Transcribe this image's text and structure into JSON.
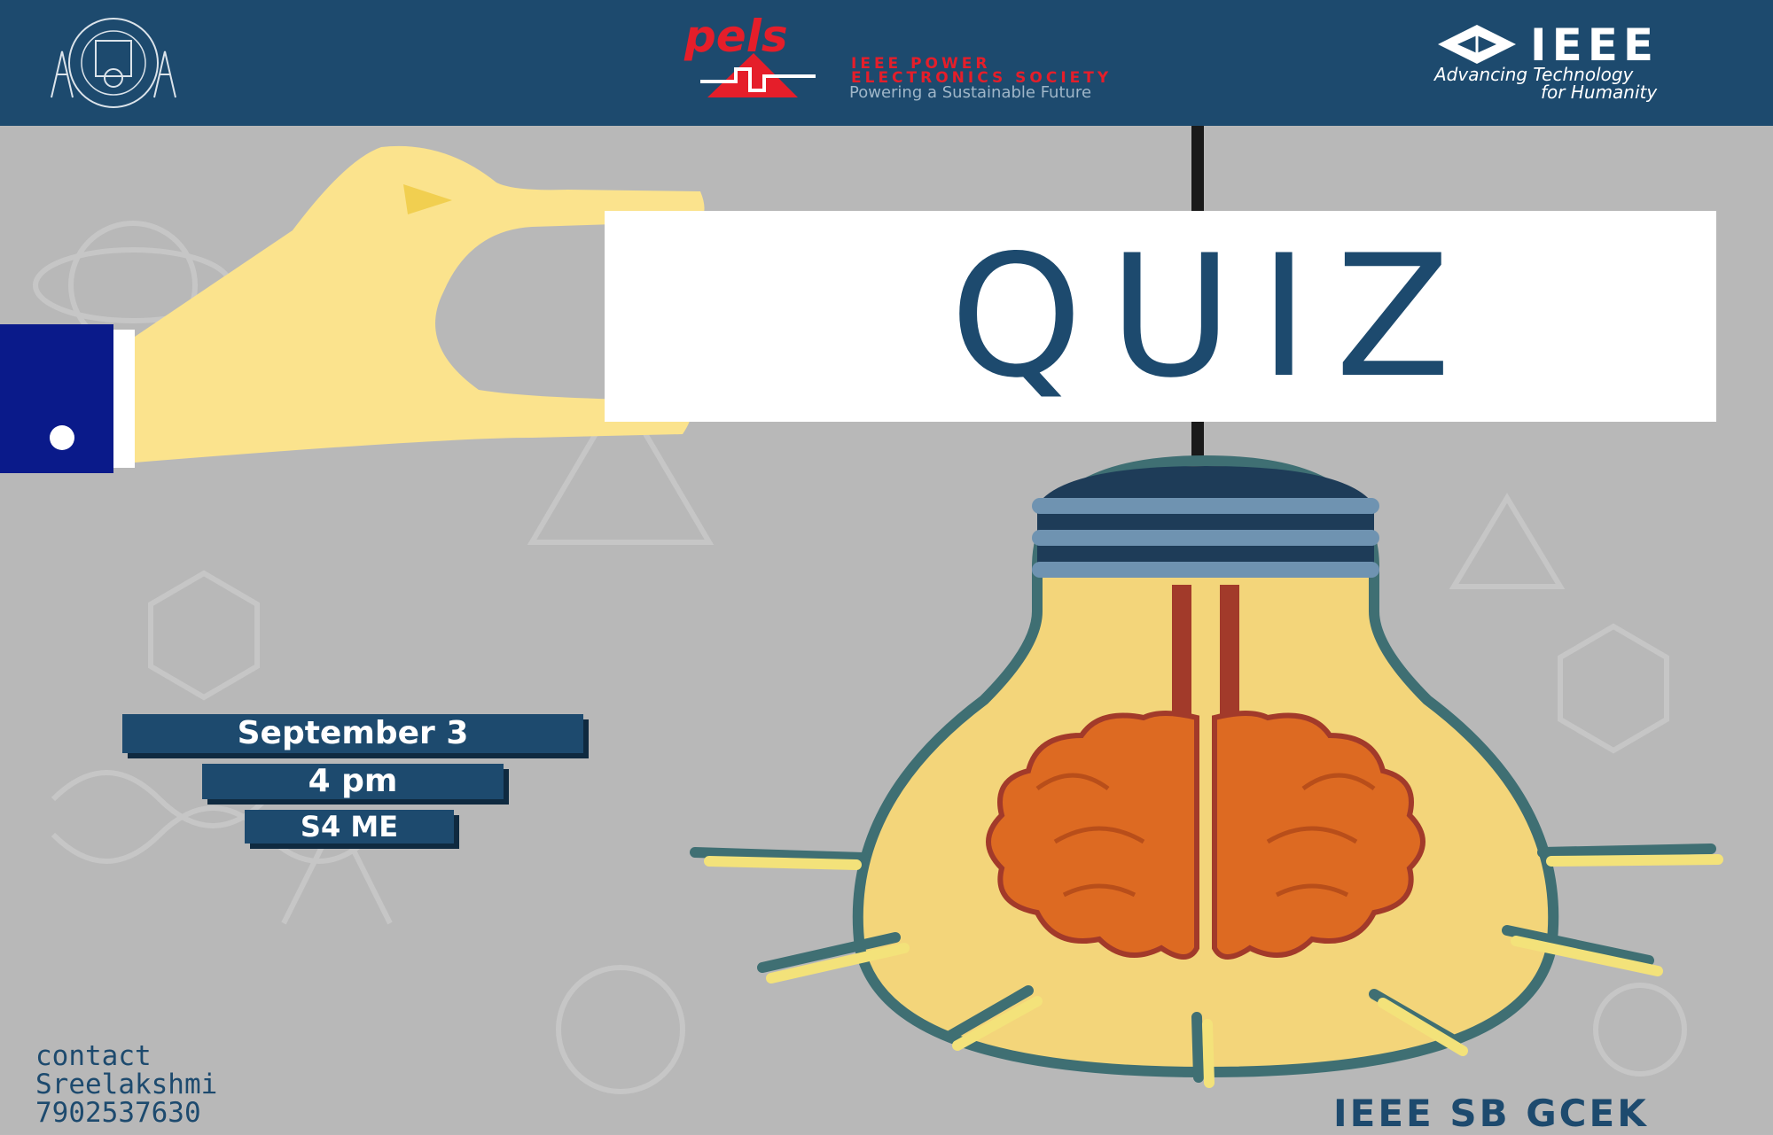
{
  "header": {
    "college_seal": "college-seal-icon",
    "pels": {
      "logo_text": "pels",
      "line1": "IEEE POWER",
      "line2": "ELECTRONICS SOCIETY",
      "tagline": "Powering a Sustainable Future"
    },
    "ieee": {
      "word": "IEEE",
      "tag_line1": "Advancing Technology",
      "tag_line2": "for Humanity"
    }
  },
  "poster": {
    "title": "QUIZ",
    "details": {
      "date": "September 3",
      "time": "4 pm",
      "venue": "S4 ME"
    },
    "contact": {
      "label": "contact",
      "name": "Sreelakshmi",
      "phone": "7902537630"
    },
    "branch": "IEEE SB GCEK"
  },
  "colors": {
    "header": "#1d4a6e",
    "background": "#b8b8b8",
    "hand": "#fbe38d",
    "sleeve": "#0a1a8a",
    "bulb": "#f3d57a",
    "brain": "#dd6a22",
    "accent_red": "#e51e2a"
  }
}
